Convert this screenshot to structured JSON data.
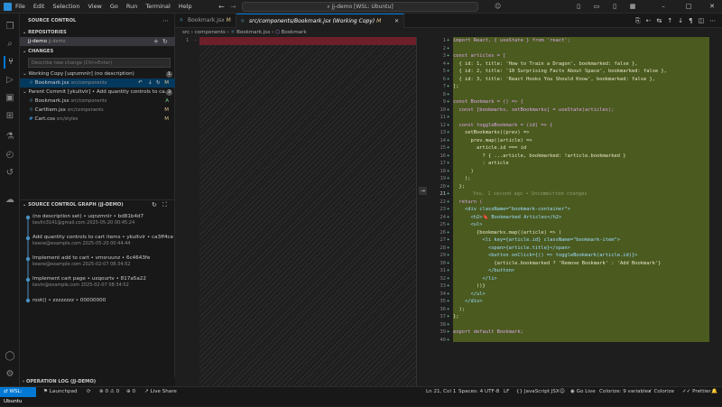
{
  "titlebar": {
    "menu": [
      "File",
      "Edit",
      "Selection",
      "View",
      "Go",
      "Run",
      "Terminal",
      "Help"
    ],
    "command_center": "jj-demo [WSL: Ubuntu]"
  },
  "sidebar": {
    "title": "SOURCE CONTROL",
    "repositories_header": "REPOSITORIES",
    "repo_name": "jj-demo",
    "repo_sub": "jj-demo",
    "changes_header": "CHANGES",
    "message_placeholder": "Describe new change (Ctrl+Enter)",
    "working_copy": {
      "label": "Working Copy [uqnzmnlr] (no description)",
      "count": "1"
    },
    "working_files": [
      {
        "name": "Bookmark.jsx",
        "path": "src/components",
        "status": "M"
      }
    ],
    "parent_commit": {
      "label": "Parent Commit [ykultvlr] • Add quantity controls to ca...",
      "count": "3"
    },
    "parent_files": [
      {
        "name": "Bookmark.jsx",
        "path": "src/components",
        "status": "A"
      },
      {
        "name": "CartItem.jsx",
        "path": "src/components",
        "status": "M"
      },
      {
        "name": "Cart.css",
        "path": "src/styles",
        "status": "M"
      }
    ],
    "graph_header": "SOURCE CONTROL GRAPH (JJ-DEMO)",
    "graph": [
      {
        "title": "(no description set) • uqnzmnlr • bd81b4d7",
        "meta": "kevlin3141@gmail.com 2025-05-20 00:45:24"
      },
      {
        "title": "Add quantity controls to cart items • ykultvlr • ca3ff4ce",
        "meta": "keane@example.com 2025-05-20 00:44:44"
      },
      {
        "title": "Implement add to cart • vmsruunz • 6c4643fe",
        "meta": "keane@example.com 2025-02-07 08:34:52"
      },
      {
        "title": "Implement cart page • uxqourtv • 817a5a22",
        "meta": "kevin@example.com 2025-02-07 08:34:52"
      },
      {
        "title": "root() • zzzzzzzz • 00000000",
        "meta": ""
      }
    ],
    "oplog_header": "OPERATION LOG (JJ-DEMO)"
  },
  "tabs": [
    {
      "label": "Bookmark.jsx",
      "badge": "M"
    },
    {
      "label": "src/components/Bookmark.jsx (Working Copy)",
      "badge": "M"
    }
  ],
  "breadcrumb": [
    "src",
    "components",
    "Bookmark.jsx",
    "Bookmark"
  ],
  "code_lines": [
    "import React, { useState } from 'react';",
    "",
    "const articles = [",
    "  { id: 1, title: 'How to Train a Dragon', bookmarked: false },",
    "  { id: 2, title: '10 Surprising Facts About Space', bookmarked: false },",
    "  { id: 3, title: 'React Hooks You Should Know', bookmarked: false },",
    "];",
    "",
    "const Bookmark = () => {",
    "  const [bookmarks, setBookmarks] = useState(articles);",
    "",
    "  const toggleBookmark = (id) => {",
    "    setBookmarks((prev) =>",
    "      prev.map((article) =>",
    "        article.id === id",
    "          ? { ...article, bookmarked: !article.bookmarked }",
    "          : article",
    "      )",
    "    );",
    "  };",
    "",
    "  return (",
    "    <div className=\"bookmark-container\">",
    "      <h2>🔖 Bookmarked Articles</h2>",
    "      <ul>",
    "        {bookmarks.map((article) => (",
    "          <li key={article.id} className=\"bookmark-item\">",
    "            <span>{article.title}</span>",
    "            <button onClick={() => toggleBookmark(article.id)}>",
    "              {article.bookmarked ? 'Remove Bookmark' : 'Add Bookmark'}",
    "            </button>",
    "          </li>",
    "        ))}",
    "      </ul>",
    "    </div>",
    "  );",
    "};",
    "",
    "export default Bookmark;",
    ""
  ],
  "blame_line21": "You, 1 second ago • Uncommitted changes",
  "status": {
    "remote": "WSL: Ubuntu",
    "launchpad": "Launchpad",
    "problems": "0 ⚠ 0",
    "ports": "0",
    "liveshare": "Live Share",
    "position": "Ln 21, Col 1",
    "spaces": "Spaces: 4",
    "encoding": "UTF-8",
    "eol": "LF",
    "language": "JavaScript JSX",
    "golive": "Go Live",
    "colorize": "Colorize: 9 variables",
    "colorize2": "Colorize",
    "prettier": "Prettier"
  }
}
